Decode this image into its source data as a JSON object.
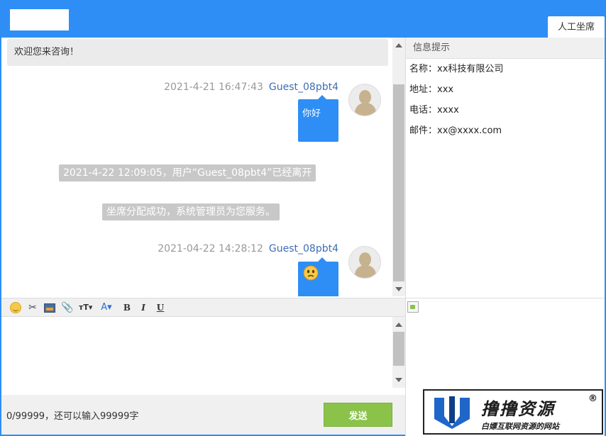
{
  "header": {
    "agent_tab": "人工坐席"
  },
  "chat": {
    "welcome": "欢迎您来咨询！",
    "messages": [
      {
        "time": "2021-4-21 16:47:43",
        "user": "Guest_08pbt4",
        "text": "你好"
      },
      {
        "time": "2021-04-22 14:28:12",
        "user": "Guest_08pbt4",
        "emoji": "confused-face"
      }
    ],
    "notices": [
      "2021-4-22 12:09:05，用户“Guest_08pbt4”已经离开",
      "坐席分配成功，系统管理员为您服务。"
    ]
  },
  "info": {
    "title": "信息提示",
    "lines": [
      "名称：xx科技有限公司",
      "地址：xxx",
      "电话：xxxx",
      "邮件：xx@xxxx.com"
    ]
  },
  "toolbar": {
    "fontsize_label": "тT▾",
    "fontcolor_label": "A▾",
    "bold_label": "B",
    "italic_label": "I",
    "underline_label": "U"
  },
  "footer": {
    "char_count": "0/99999，还可以输入99999字",
    "send_label": "发送"
  },
  "watermark": {
    "title": "撸撸资源",
    "subtitle": "白嫖互联网资源的网站",
    "mark": "®"
  },
  "colors": {
    "header": "#2e8ef5",
    "bubble": "#2e8ef5",
    "send": "#8bc34a",
    "notice": "#c8c8c8"
  }
}
